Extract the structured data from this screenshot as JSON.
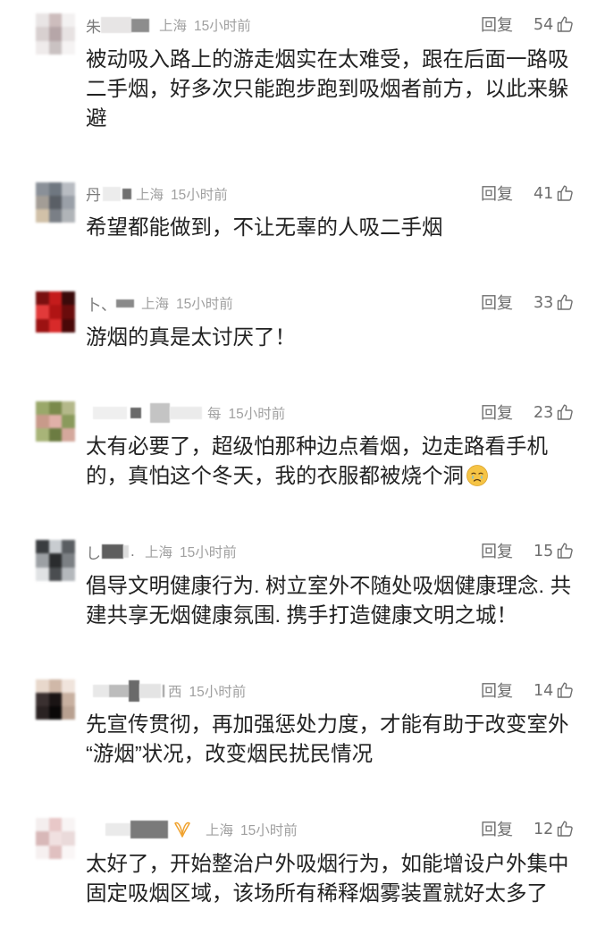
{
  "reply_label": "回复",
  "icons": {
    "like": "thumbs-up-icon",
    "member_badge": "member-badge-icon",
    "emoji": "crying-face-icon"
  },
  "colors": {
    "text": "#222222",
    "meta": "#a0a0a0",
    "action": "#6e6e6e",
    "badge": "#f0a22e",
    "background": "#ffffff"
  },
  "comments": [
    {
      "user_visible": "朱",
      "location": "上海",
      "time": "15小时前",
      "likes": "54",
      "avatar_colors": [
        "#e9e5e5",
        "#cdbdbd",
        "#f3f1f1",
        "#d8d0d0",
        "#b6a6a8",
        "#e7e2e2",
        "#efebeb",
        "#cac2c2",
        "#f5f3f3"
      ],
      "text_lines": [
        "被动吸入路上的游走烟实在太难受，跟在后面一路吸",
        "二手烟，好多次只能跑步跑到吸烟者前方，以此来躲",
        "避"
      ]
    },
    {
      "user_visible": "丹",
      "location": "上海",
      "time": "15小时前",
      "likes": "41",
      "avatar_colors": [
        "#8a9098",
        "#6f7780",
        "#b8bcc2",
        "#a39d96",
        "#5a5f66",
        "#9aa0a8",
        "#d1c1a8",
        "#7a7f86",
        "#b0b4b8"
      ],
      "text_lines": [
        "希望都能做到，不让无辜的人吸二手烟"
      ]
    },
    {
      "user_visible": "卜、",
      "location": "上海",
      "time": "15小时前",
      "likes": "33",
      "avatar_colors": [
        "#7a1010",
        "#c41c1c",
        "#3a0a0a",
        "#e23a3a",
        "#b01414",
        "#6a0c0c",
        "#9c1212",
        "#d82a2a",
        "#4a0808"
      ],
      "text_lines": [
        "游烟的真是太讨厌了！"
      ]
    },
    {
      "location": "每",
      "time": "15小时前",
      "likes": "23",
      "avatar_colors": [
        "#9aa86a",
        "#7a8a4c",
        "#b4b88a",
        "#c89a8a",
        "#e0b0a8",
        "#8a9a5c",
        "#a8b478",
        "#6c7c42",
        "#d4a89c"
      ],
      "emoji": "crying-face-icon",
      "text_lines": [
        "太有必要了，超级怕那种边点着烟，边走路看手机",
        "的，真怕这个冬天，我的衣服都被烧个洞"
      ]
    },
    {
      "user_visible": "し",
      "user_tail": ".",
      "location": "上海",
      "time": "15小时前",
      "likes": "15",
      "avatar_colors": [
        "#3a3d40",
        "#c8ccd0",
        "#5a5e62",
        "#9ca0a4",
        "#2a2c2e",
        "#7c8084",
        "#e0e2e4",
        "#4a4d50",
        "#b4b8bc"
      ],
      "text_lines": [
        "倡导文明健康行为. 树立室外不随处吸烟健康理念. 共",
        "建共享无烟健康氛围. 携手打造健康文明之城！"
      ]
    },
    {
      "location": "西",
      "time": "15小时前",
      "likes": "14",
      "avatar_colors": [
        "#e8d8cc",
        "#d0b8a8",
        "#f0e4dc",
        "#3a3030",
        "#1a1414",
        "#c8b0a0",
        "#2a2222",
        "#0a0808",
        "#b8a090"
      ],
      "text_lines": [
        "先宣传贯彻，再加强惩处力度，才能有助于改变室外",
        "“游烟”状况，改变烟民扰民情况"
      ]
    },
    {
      "location": "上海",
      "time": "15小时前",
      "likes": "12",
      "member_badge": "member-badge-icon",
      "avatar_colors": [
        "#f4eeee",
        "#e8c8c8",
        "#f8f4f4",
        "#d8b8b8",
        "#f0e0e0",
        "#eadada",
        "#f6f0f0",
        "#e0c0c0",
        "#faf6f6"
      ],
      "text_lines": [
        "太好了，开始整治户外吸烟行为，如能增设户外集中",
        "固定吸烟区域，该场所有稀释烟雾装置就好太多了"
      ]
    }
  ]
}
